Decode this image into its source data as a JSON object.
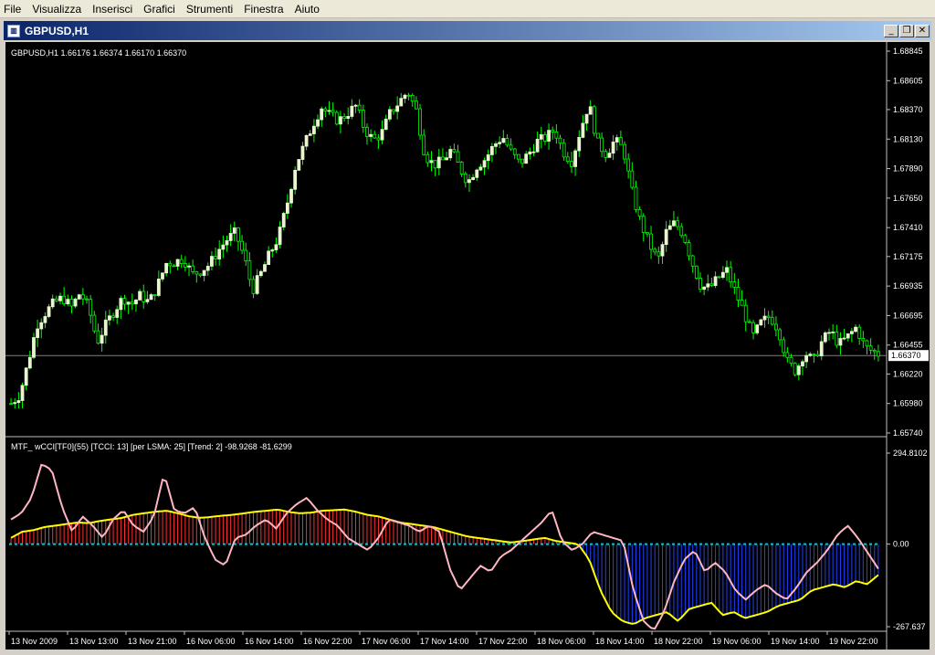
{
  "menu": [
    "File",
    "Visualizza",
    "Inserisci",
    "Grafici",
    "Strumenti",
    "Finestra",
    "Aiuto"
  ],
  "window": {
    "title": "GBPUSD,H1",
    "icon": "chart-window-icon",
    "buttons": [
      "minimize-icon",
      "restore-icon",
      "close-icon"
    ]
  },
  "colors": {
    "background": "#000000",
    "grid": "#c0c0c0",
    "candle_up": "#e8f5d0",
    "candle_wick": "#00ff00",
    "cci_line": "#ffb6c1",
    "trend_line": "#ffff00",
    "zero_line": "#00c8d8",
    "hist_up": "#ff3030",
    "hist_down": "#2040ff",
    "price_line": "#808080",
    "text": "#ffffff"
  },
  "main_chart": {
    "label": "GBPUSD,H1  1.66176 1.66374 1.66170 1.66370",
    "y_ticks": [
      "1.68845",
      "1.68605",
      "1.68370",
      "1.68130",
      "1.67890",
      "1.67650",
      "1.67410",
      "1.67175",
      "1.66935",
      "1.66695",
      "1.66455",
      "1.66220",
      "1.65980",
      "1.65740"
    ],
    "y_tick_values": [
      1.68845,
      1.68605,
      1.6837,
      1.6813,
      1.6789,
      1.6765,
      1.6741,
      1.67175,
      1.66935,
      1.66695,
      1.66455,
      1.6622,
      1.6598,
      1.6574
    ],
    "current_price": "1.66370",
    "current_price_value": 1.6637
  },
  "indicator": {
    "label": "MTF_ wCCI[TF0](55) [TCCI: 13] [per LSMA: 25] [Trend: 2]  -98.9268 -81.6299",
    "y_ticks": [
      "294.8102",
      "0.00",
      "-267.637"
    ],
    "y_tick_values": [
      294.8102,
      0,
      -267.637
    ]
  },
  "x_labels": [
    "13 Nov 2009",
    "13 Nov 13:00",
    "13 Nov 21:00",
    "16 Nov 06:00",
    "16 Nov 14:00",
    "16 Nov 22:00",
    "17 Nov 06:00",
    "17 Nov 14:00",
    "17 Nov 22:00",
    "18 Nov 06:00",
    "18 Nov 14:00",
    "18 Nov 22:00",
    "19 Nov 06:00",
    "19 Nov 14:00",
    "19 Nov 22:00"
  ],
  "chart_data": {
    "type": "line",
    "title": "GBPUSD,H1",
    "price_path": [
      1.6598,
      1.6605,
      1.6632,
      1.6662,
      1.6672,
      1.668,
      1.6684,
      1.6676,
      1.6688,
      1.6676,
      1.6648,
      1.6662,
      1.6674,
      1.6684,
      1.6679,
      1.6686,
      1.668,
      1.6694,
      1.6712,
      1.6713,
      1.6716,
      1.6703,
      1.6706,
      1.6711,
      1.6722,
      1.6731,
      1.6737,
      1.6718,
      1.669,
      1.6704,
      1.672,
      1.6733,
      1.676,
      1.6792,
      1.6808,
      1.6825,
      1.6839,
      1.6832,
      1.6828,
      1.6834,
      1.684,
      1.6821,
      1.6812,
      1.6818,
      1.6835,
      1.6843,
      1.6852,
      1.6836,
      1.68,
      1.6792,
      1.6795,
      1.6804,
      1.679,
      1.6778,
      1.6791,
      1.6797,
      1.6808,
      1.6815,
      1.6802,
      1.6793,
      1.6801,
      1.6811,
      1.6814,
      1.6821,
      1.6803,
      1.6795,
      1.682,
      1.6842,
      1.681,
      1.6801,
      1.6812,
      1.6805,
      1.677,
      1.6745,
      1.6728,
      1.6714,
      1.6738,
      1.6745,
      1.6735,
      1.6712,
      1.6693,
      1.6692,
      1.67,
      1.6706,
      1.6688,
      1.6672,
      1.6652,
      1.6664,
      1.6669,
      1.6658,
      1.6632,
      1.6624,
      1.664,
      1.6632,
      1.6648,
      1.6657,
      1.6646,
      1.6652,
      1.666,
      1.6644,
      1.664,
      1.6637
    ],
    "cci_path": [
      80,
      100,
      150,
      260,
      240,
      120,
      40,
      90,
      60,
      20,
      80,
      110,
      60,
      40,
      90,
      230,
      110,
      100,
      120,
      20,
      -50,
      -70,
      20,
      30,
      60,
      80,
      50,
      100,
      130,
      150,
      110,
      80,
      60,
      20,
      0,
      -20,
      20,
      80,
      70,
      60,
      40,
      60,
      40,
      -80,
      -150,
      -110,
      -70,
      -90,
      -40,
      -20,
      10,
      40,
      70,
      110,
      10,
      -20,
      0,
      40,
      30,
      20,
      10,
      -150,
      -250,
      -280,
      -220,
      -120,
      -50,
      -20,
      -90,
      -60,
      -90,
      -150,
      -180,
      -150,
      -130,
      -160,
      -180,
      -140,
      -90,
      -60,
      -20,
      30,
      60,
      20,
      -30,
      -80
    ],
    "trend_path": [
      20,
      40,
      45,
      55,
      60,
      65,
      70,
      68,
      75,
      80,
      85,
      95,
      100,
      105,
      108,
      100,
      90,
      85,
      88,
      92,
      95,
      100,
      105,
      108,
      112,
      104,
      100,
      102,
      108,
      110,
      112,
      105,
      95,
      90,
      80,
      70,
      65,
      60,
      55,
      45,
      35,
      25,
      20,
      15,
      10,
      5,
      10,
      15,
      20,
      10,
      5,
      0,
      -50,
      -150,
      -220,
      -250,
      -260,
      -240,
      -230,
      -220,
      -250,
      -210,
      -200,
      -190,
      -230,
      -220,
      -240,
      -230,
      -220,
      -200,
      -190,
      -180,
      -150,
      -140,
      -130,
      -140,
      -120,
      -130,
      -100
    ],
    "x_labels": [
      "13 Nov 2009",
      "13 Nov 13:00",
      "13 Nov 21:00",
      "16 Nov 06:00",
      "16 Nov 14:00",
      "16 Nov 22:00",
      "17 Nov 06:00",
      "17 Nov 14:00",
      "17 Nov 22:00",
      "18 Nov 06:00",
      "18 Nov 14:00",
      "18 Nov 22:00",
      "19 Nov 06:00",
      "19 Nov 14:00",
      "19 Nov 22:00"
    ],
    "ylim": [
      1.6574,
      1.68845
    ],
    "indicator_ylim": [
      -267.637,
      294.8102
    ],
    "grid": false
  }
}
